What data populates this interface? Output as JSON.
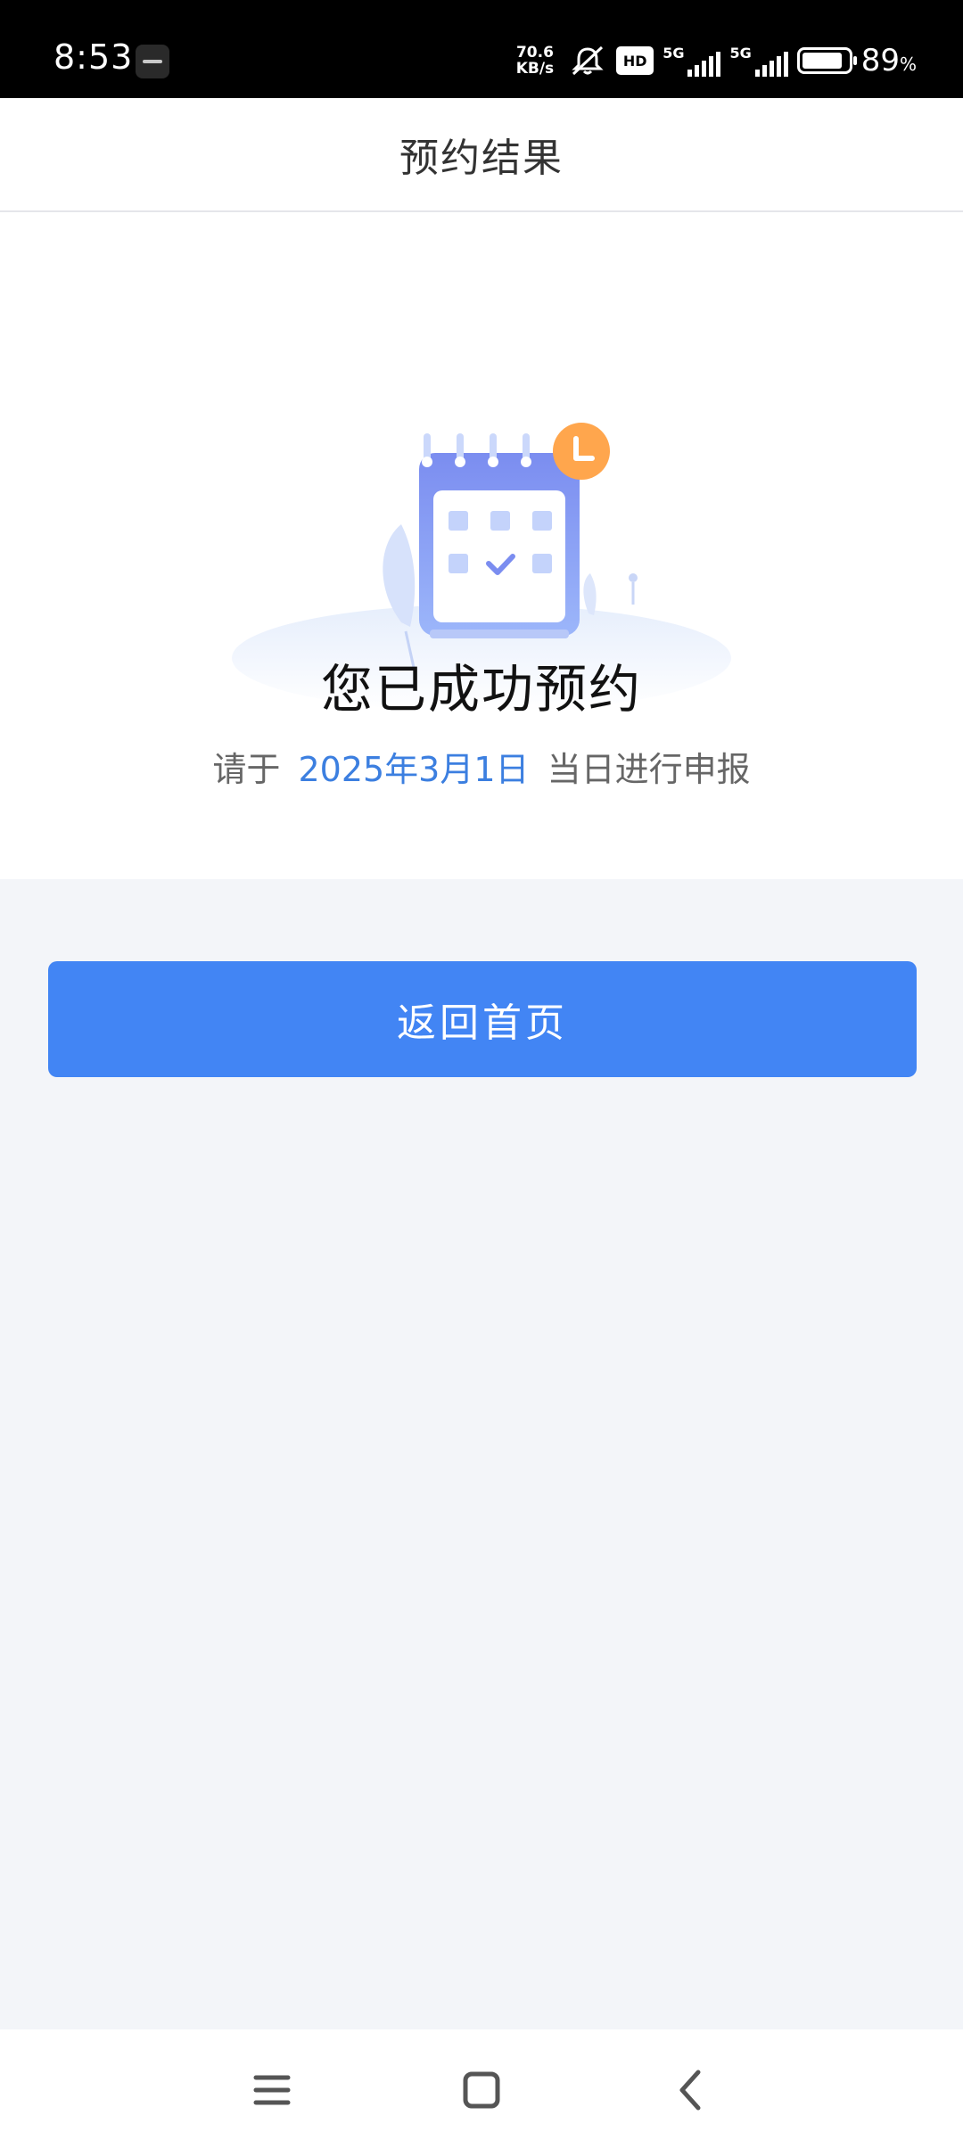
{
  "status_bar": {
    "time": "8:53",
    "net_speed_value": "70.6",
    "net_speed_unit": "KB/s",
    "hd_label": "HD",
    "network_1": "5G",
    "network_2": "5G",
    "battery_percent": "89",
    "battery_unit": "%",
    "battery_level": 0.89
  },
  "header": {
    "title": "预约结果"
  },
  "result": {
    "title": "您已成功预约",
    "desc_prefix": "请于",
    "date": "2025年3月1日",
    "desc_suffix": "当日进行申报"
  },
  "actions": {
    "home_button_label": "返回首页"
  },
  "colors": {
    "primary": "#4285f4",
    "date_highlight": "#3c7fe0",
    "page_background": "#f3f5f9",
    "clock_badge": "#ffa64d"
  },
  "icons": {
    "illustration": "calendar-check-icon",
    "system_nav": [
      "menu-icon",
      "home-icon",
      "back-icon"
    ]
  }
}
